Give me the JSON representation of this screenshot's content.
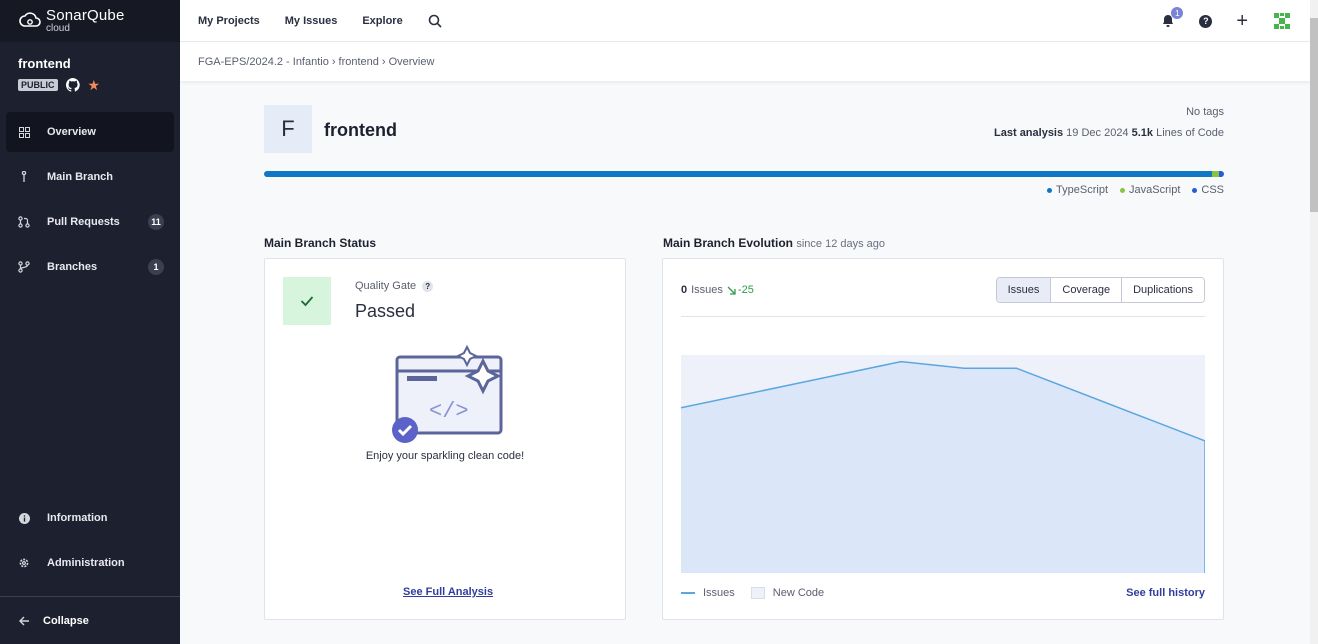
{
  "brand": {
    "name": "SonarQube",
    "sub": "cloud"
  },
  "project": {
    "name": "frontend",
    "visibility": "PUBLIC"
  },
  "nav": {
    "overview": "Overview",
    "main_branch": "Main Branch",
    "pull_requests": "Pull Requests",
    "pull_requests_count": "11",
    "branches": "Branches",
    "branches_count": "1",
    "information": "Information",
    "administration": "Administration",
    "collapse": "Collapse"
  },
  "topbar": {
    "my_projects": "My Projects",
    "my_issues": "My Issues",
    "explore": "Explore",
    "notifications_count": "1",
    "help": "?"
  },
  "breadcrumb": [
    "FGA-EPS/2024.2 - Infantio",
    "frontend",
    "Overview"
  ],
  "header": {
    "avatar_letter": "F",
    "title": "frontend",
    "tags": "No tags",
    "last_analysis_label": "Last analysis",
    "last_analysis_date": "19 Dec 2024",
    "loc_value": "5.1k",
    "loc_label": "Lines of Code"
  },
  "languages": [
    {
      "name": "TypeScript",
      "color": "#0f77c4",
      "share": 0.988
    },
    {
      "name": "JavaScript",
      "color": "#88c443",
      "share": 0.007
    },
    {
      "name": "CSS",
      "color": "#2a5bd7",
      "share": 0.005
    }
  ],
  "status": {
    "section_title": "Main Branch Status",
    "qg_label": "Quality Gate",
    "qg_help": "?",
    "qg_status": "Passed",
    "caption": "Enjoy your sparkling clean code!",
    "link": "See Full Analysis"
  },
  "evolution": {
    "section_title": "Main Branch Evolution",
    "since": "since 12 days ago",
    "issues_value": "0",
    "issues_label": "Issues",
    "delta": "-25",
    "tabs": [
      "Issues",
      "Coverage",
      "Duplications"
    ],
    "active_tab": "Issues",
    "legend_issues": "Issues",
    "legend_new_code": "New Code",
    "link": "See full history"
  },
  "chart_data": {
    "type": "area",
    "series": [
      {
        "name": "Issues",
        "values": [
          25,
          32,
          31,
          31,
          20,
          0
        ]
      }
    ],
    "x": [
      0,
      0.42,
      0.54,
      0.64,
      1,
      1
    ],
    "ylim": [
      0,
      33
    ]
  }
}
